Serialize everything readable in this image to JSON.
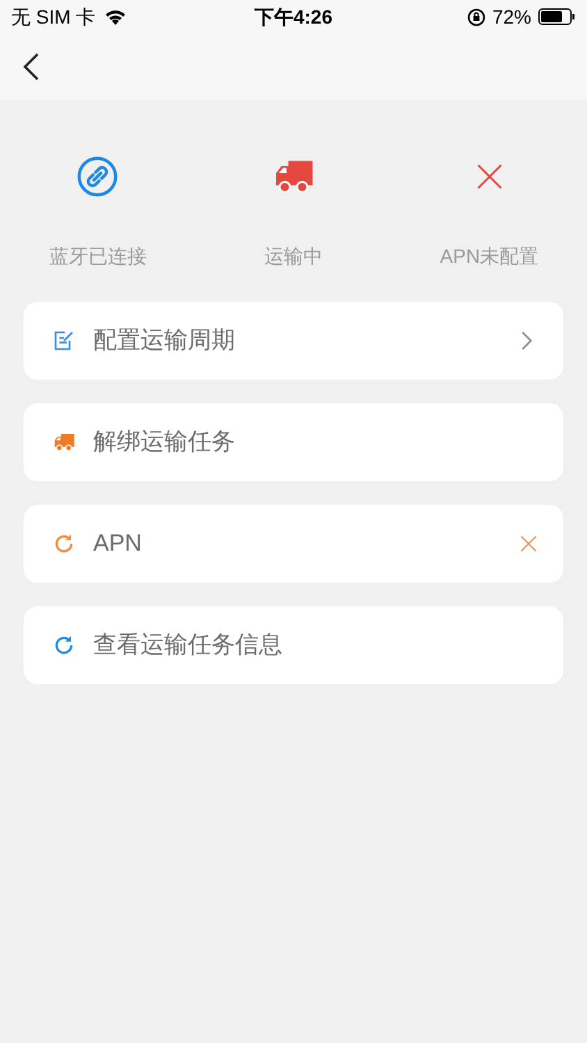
{
  "status_bar": {
    "carrier": "无 SIM 卡",
    "time": "下午4:26",
    "battery": "72%"
  },
  "device_status": [
    {
      "kind": "link",
      "color": "#1e88e5",
      "label": "蓝牙已连接"
    },
    {
      "kind": "truck",
      "color": "#e5483f",
      "label": "运输中"
    },
    {
      "kind": "cross",
      "color": "#e5483f",
      "label": "APN未配置"
    }
  ],
  "menu": [
    {
      "kind": "edit",
      "color": "#3a8ee6",
      "label": "配置运输周期",
      "trailing": {
        "kind": "chevron"
      }
    },
    {
      "kind": "truck",
      "color": "#f07a28",
      "label": "解绑运输任务"
    },
    {
      "kind": "refresh",
      "color": "#f08a3c",
      "label": "APN",
      "trailing": {
        "kind": "cross"
      }
    },
    {
      "kind": "refresh",
      "color": "#1e88e5",
      "label": "查看运输任务信息"
    }
  ]
}
